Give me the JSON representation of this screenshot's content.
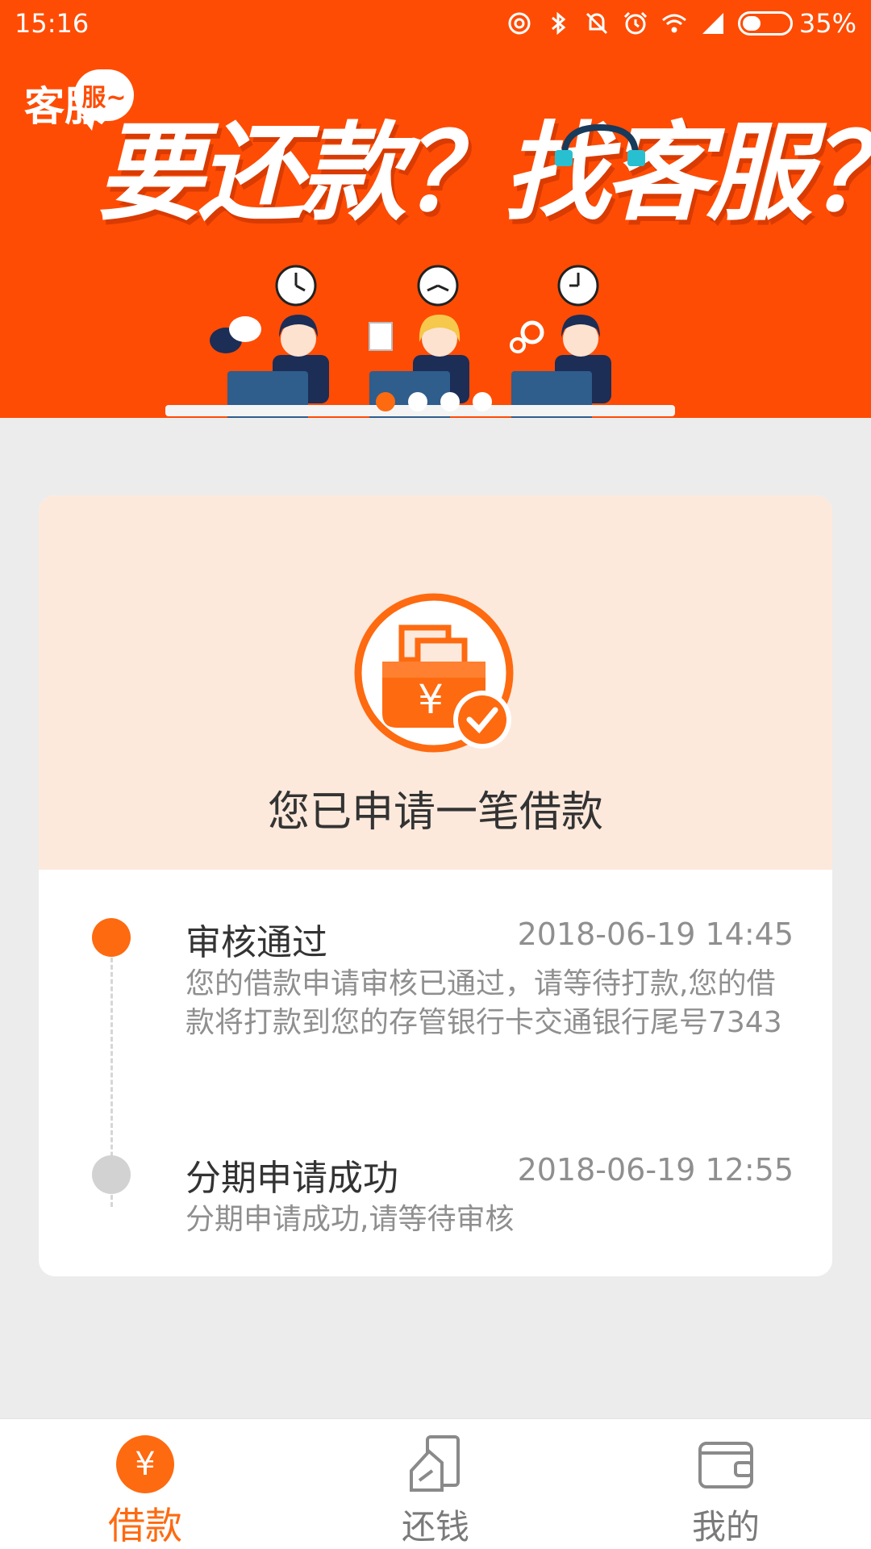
{
  "status_bar": {
    "time": "15:16",
    "battery_percent": "35%",
    "icons": [
      "hotspot-icon",
      "bluetooth-icon",
      "vibrate-off-icon",
      "alarm-icon",
      "wifi-icon",
      "signal-icon",
      "battery-icon"
    ]
  },
  "banner": {
    "badge_text": "客服",
    "badge_bubble": "服~",
    "headline": "要还款？找客服？",
    "carousel": {
      "count": 4,
      "active_index": 0
    }
  },
  "loan_status": {
    "title": "您已申请一笔借款",
    "accent": "#fe6a10",
    "timeline": [
      {
        "title": "审核通过",
        "time": "2018-06-19 14:45",
        "description": "您的借款申请审核已通过，请等待打款,您的借款将打款到您的存管银行卡交通银行尾号7343",
        "state": "done"
      },
      {
        "title": "分期申请成功",
        "time": "2018-06-19 12:55",
        "description": "分期申请成功,请等待审核",
        "state": "pending"
      }
    ]
  },
  "bottom_nav": {
    "items": [
      {
        "label": "借款",
        "icon": "yen-circle-icon",
        "active": true
      },
      {
        "label": "还钱",
        "icon": "repay-card-icon",
        "active": false
      },
      {
        "label": "我的",
        "icon": "wallet-icon",
        "active": false
      }
    ]
  },
  "colors": {
    "banner": "#fe4c05",
    "accent": "#fe6a10",
    "card_header": "#fde9dc",
    "page_bg": "#ececec"
  }
}
